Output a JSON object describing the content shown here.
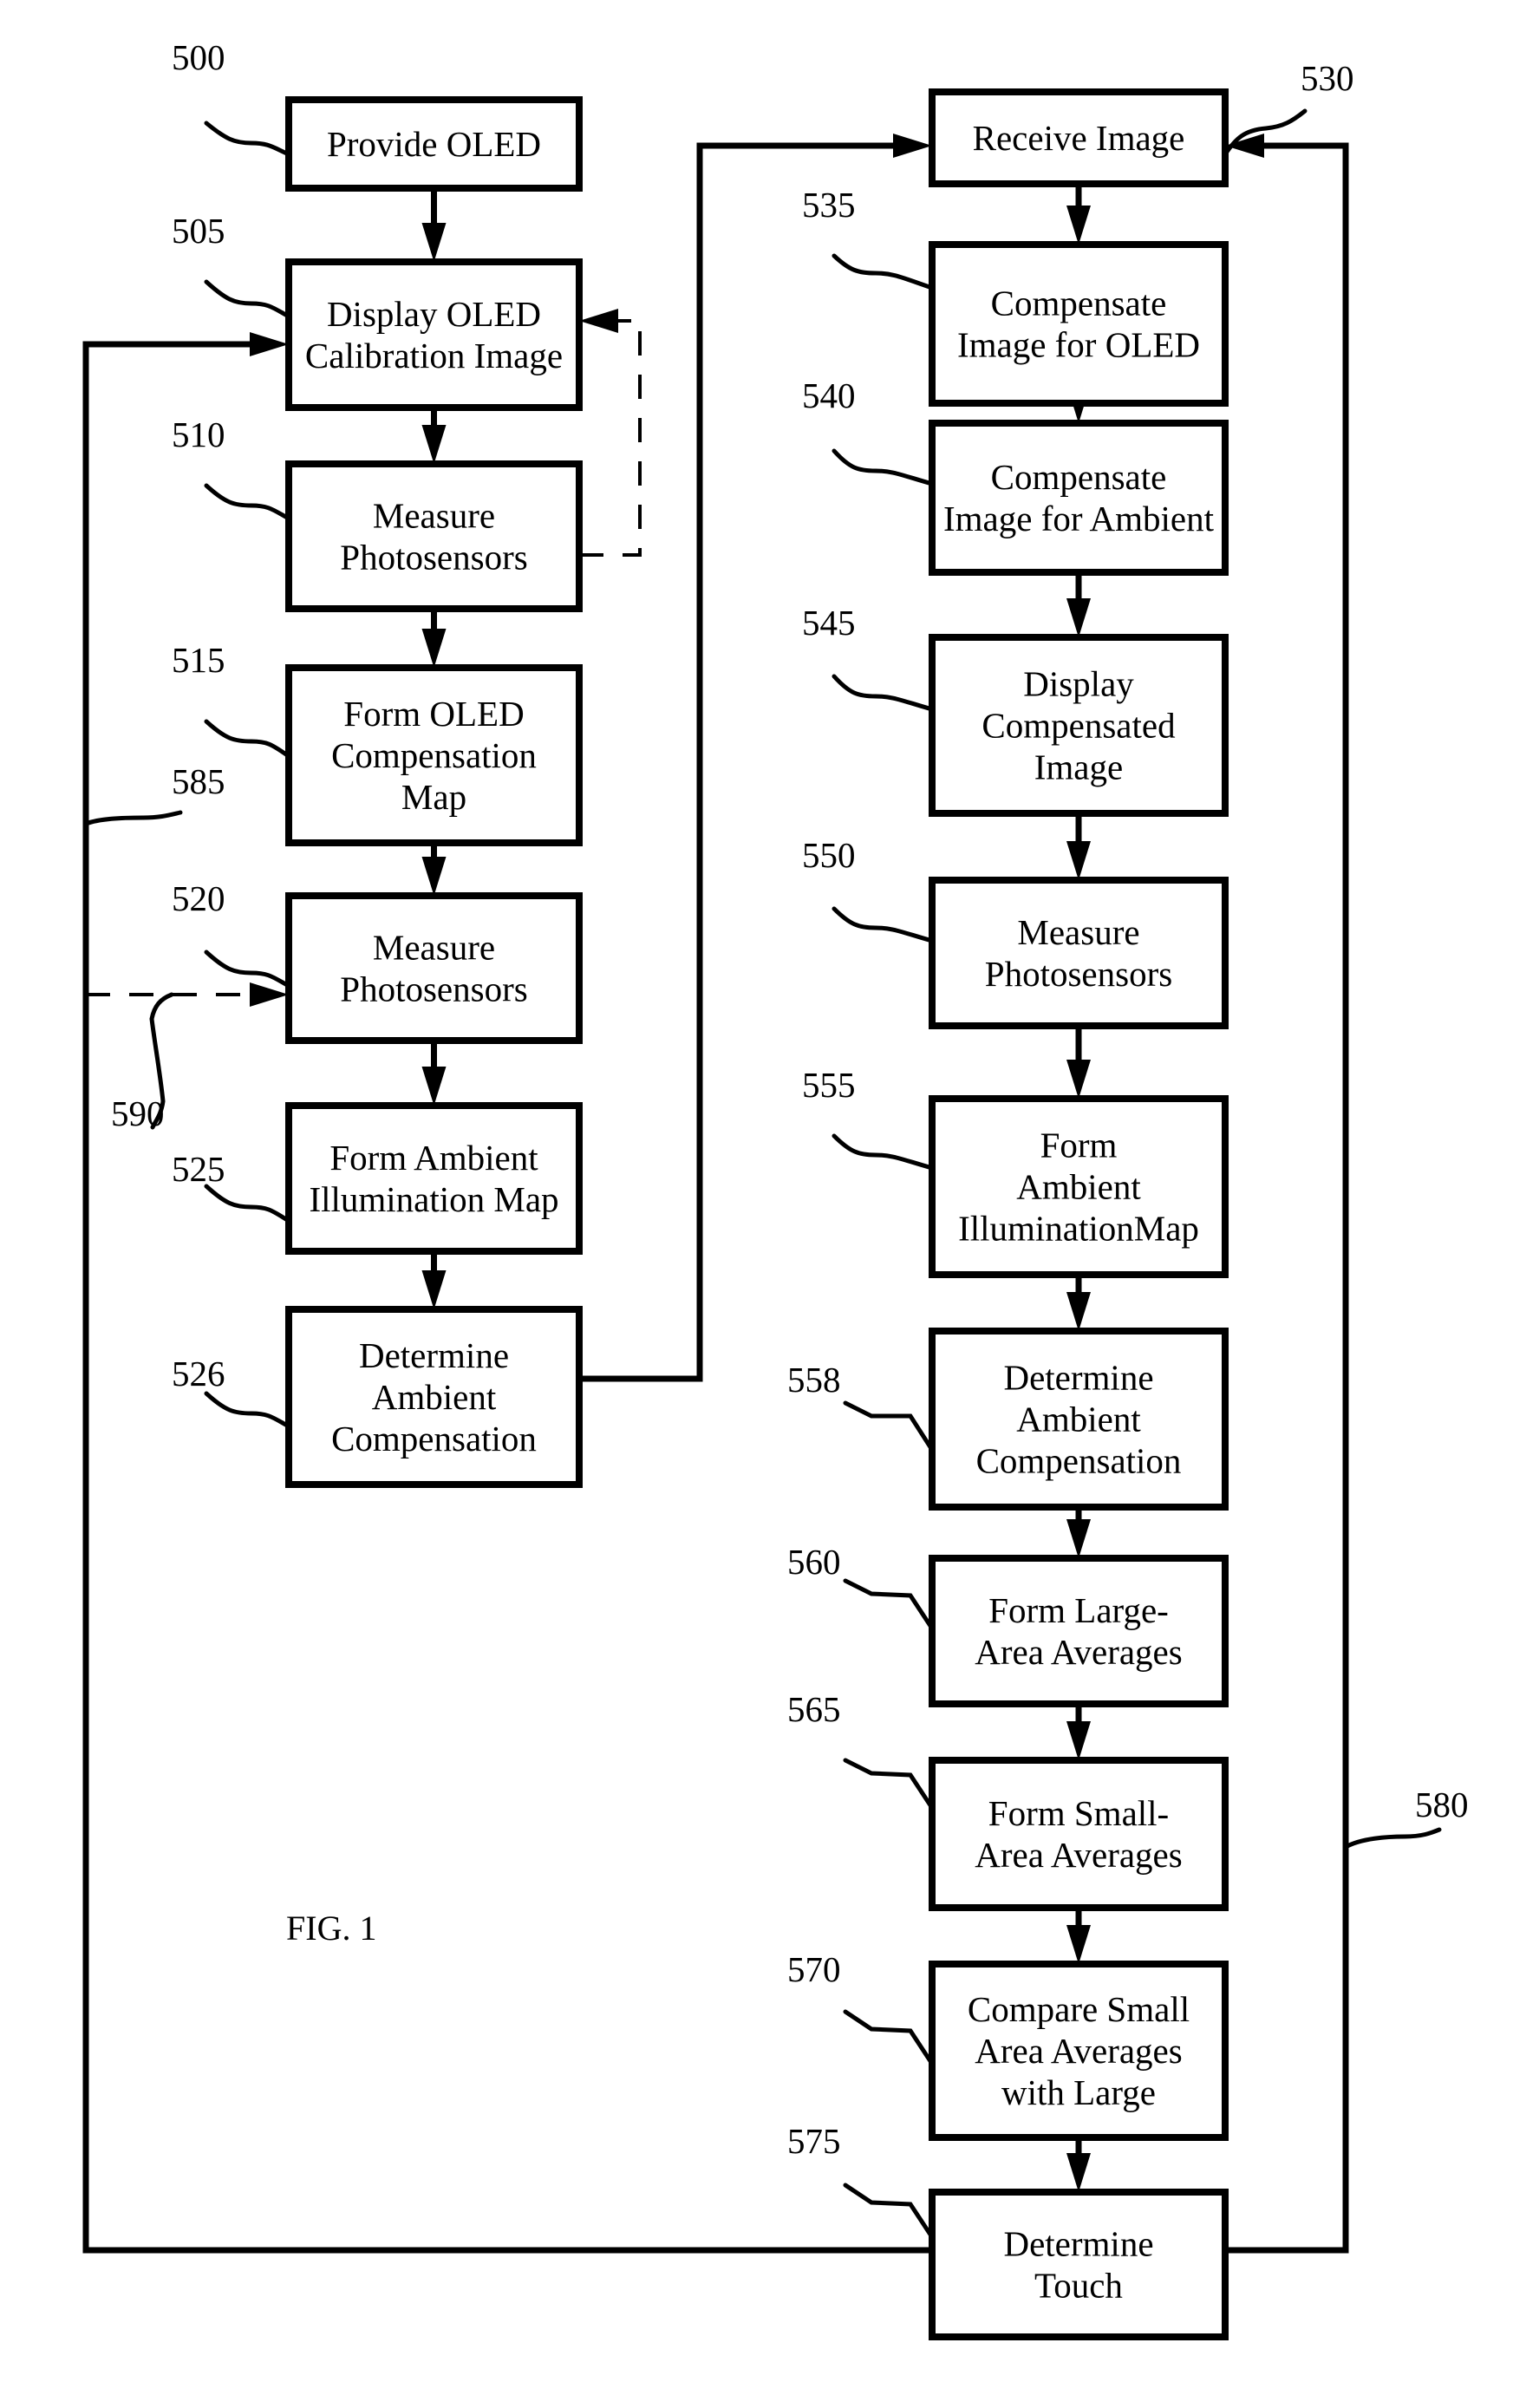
{
  "figure": {
    "caption": "FIG. 1"
  },
  "steps": [
    {
      "id": "500",
      "lines": [
        "Provide OLED"
      ]
    },
    {
      "id": "505",
      "lines": [
        "Display OLED",
        "Calibration Image"
      ]
    },
    {
      "id": "510",
      "lines": [
        "Measure",
        "Photosensors"
      ]
    },
    {
      "id": "515",
      "lines": [
        "Form OLED",
        "Compensation",
        "Map"
      ]
    },
    {
      "id": "520",
      "lines": [
        "Measure",
        "Photosensors"
      ]
    },
    {
      "id": "525",
      "lines": [
        "Form Ambient",
        "Illumination Map"
      ]
    },
    {
      "id": "526",
      "lines": [
        "Determine",
        "Ambient",
        "Compensation"
      ]
    },
    {
      "id": "530",
      "lines": [
        "Receive Image"
      ]
    },
    {
      "id": "535",
      "lines": [
        "Compensate",
        "Image for OLED"
      ]
    },
    {
      "id": "540",
      "lines": [
        "Compensate",
        "Image for Ambient"
      ]
    },
    {
      "id": "545",
      "lines": [
        "Display",
        "Compensated",
        "Image"
      ]
    },
    {
      "id": "550",
      "lines": [
        "Measure",
        "Photosensors"
      ]
    },
    {
      "id": "555",
      "lines": [
        "Form",
        "Ambient",
        "IlluminationMap"
      ]
    },
    {
      "id": "558",
      "lines": [
        "Determine",
        "Ambient",
        "Compensation"
      ]
    },
    {
      "id": "560",
      "lines": [
        "Form Large-",
        "Area Averages"
      ]
    },
    {
      "id": "565",
      "lines": [
        "Form Small-",
        "Area Averages"
      ]
    },
    {
      "id": "570",
      "lines": [
        "Compare Small",
        "Area Averages",
        "with Large"
      ]
    },
    {
      "id": "575",
      "lines": [
        "Determine",
        "Touch"
      ]
    }
  ],
  "path_refs": [
    {
      "id": "580",
      "kind": "loop"
    },
    {
      "id": "585",
      "kind": "loop"
    },
    {
      "id": "590",
      "kind": "dashed-path"
    }
  ],
  "connections": [
    {
      "from": "500",
      "to": "505",
      "style": "solid"
    },
    {
      "from": "505",
      "to": "510",
      "style": "solid"
    },
    {
      "from": "510",
      "to": "505",
      "style": "dashed"
    },
    {
      "from": "510",
      "to": "515",
      "style": "solid"
    },
    {
      "from": "515",
      "to": "520",
      "style": "solid"
    },
    {
      "from": "520",
      "to": "525",
      "style": "solid"
    },
    {
      "from": "525",
      "to": "526",
      "style": "solid"
    },
    {
      "from": "526",
      "to": "530",
      "style": "solid"
    },
    {
      "from": "530",
      "to": "535",
      "style": "solid"
    },
    {
      "from": "535",
      "to": "540",
      "style": "solid"
    },
    {
      "from": "540",
      "to": "545",
      "style": "solid"
    },
    {
      "from": "545",
      "to": "550",
      "style": "solid"
    },
    {
      "from": "550",
      "to": "555",
      "style": "solid"
    },
    {
      "from": "555",
      "to": "558",
      "style": "solid"
    },
    {
      "from": "558",
      "to": "560",
      "style": "solid"
    },
    {
      "from": "560",
      "to": "565",
      "style": "solid"
    },
    {
      "from": "565",
      "to": "570",
      "style": "solid"
    },
    {
      "from": "570",
      "to": "575",
      "style": "solid"
    },
    {
      "from": "575",
      "to": "530",
      "style": "solid",
      "label": "580"
    },
    {
      "from": "575",
      "to": "505",
      "style": "solid",
      "label": "585"
    },
    {
      "from": "585",
      "to": "520",
      "style": "dashed",
      "label": "590"
    }
  ]
}
